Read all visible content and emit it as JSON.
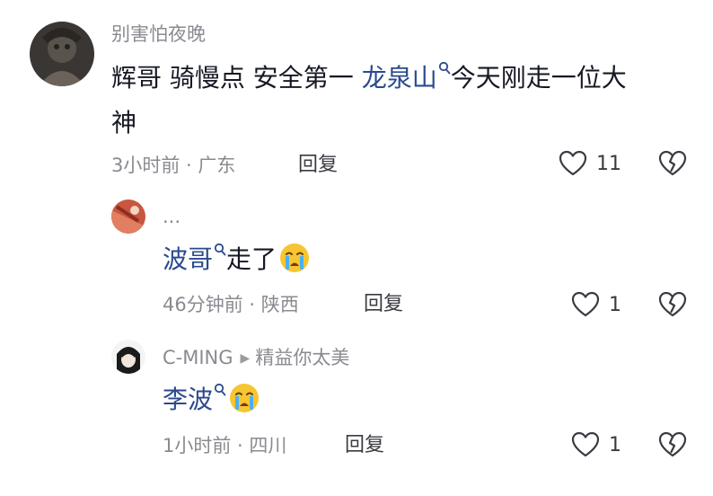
{
  "comments": [
    {
      "username": "别害怕夜晚",
      "text_before": "辉哥 骑慢点 安全第一 ",
      "link": "龙泉山",
      "text_after": "今天刚走一位大",
      "text_line2": "神",
      "time": "3小时前",
      "location": "广东",
      "reply_label": "回复",
      "likes": "11"
    },
    {
      "username": "...",
      "link": "波哥",
      "text_after": "走了",
      "emoji": "crying-face",
      "time": "46分钟前",
      "location": "陕西",
      "reply_label": "回复",
      "likes": "1"
    },
    {
      "username": "C-MING",
      "reply_to": "精益你太美",
      "link": "李波",
      "emoji": "crying-face",
      "time": "1小时前",
      "location": "四川",
      "reply_label": "回复",
      "likes": "1"
    }
  ],
  "separator": " · ",
  "colors": {
    "text": "#161823",
    "meta": "#8a8b91",
    "link": "#2b4a8e",
    "emoji": "#f7c531"
  }
}
